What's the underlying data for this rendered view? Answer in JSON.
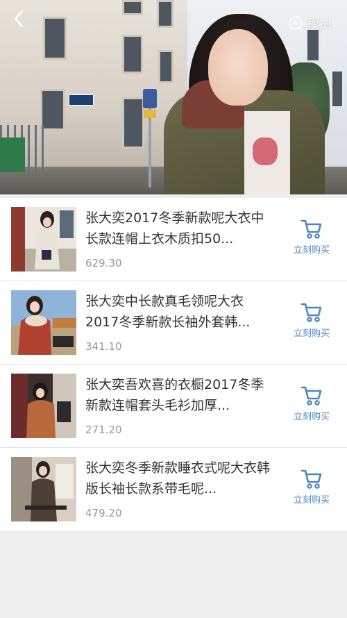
{
  "video": {
    "watermark_text": "秒拍",
    "back_icon": "chevron-left-icon",
    "watermark_icon": "eye-icon"
  },
  "products": [
    {
      "title": "张大奕2017冬季新款呢大衣中长款连帽上衣木质扣50...",
      "price": "629.30",
      "buy_label": "立刻购买"
    },
    {
      "title": "张大奕中长款真毛领呢大衣2017冬季新款长袖外套韩...",
      "price": "341.10",
      "buy_label": "立刻购买"
    },
    {
      "title": "张大奕吾欢喜的衣橱2017冬季新款连帽套头毛衫加厚...",
      "price": "271.20",
      "buy_label": "立刻购买"
    },
    {
      "title": "张大奕冬季新款睡衣式呢大衣韩版长袖长款系带毛呢...",
      "price": "479.20",
      "buy_label": "立刻购买"
    }
  ],
  "colors": {
    "accent": "#4f86c0",
    "title_text": "#333333",
    "price_text": "#999999",
    "page_bg": "#efefef"
  }
}
